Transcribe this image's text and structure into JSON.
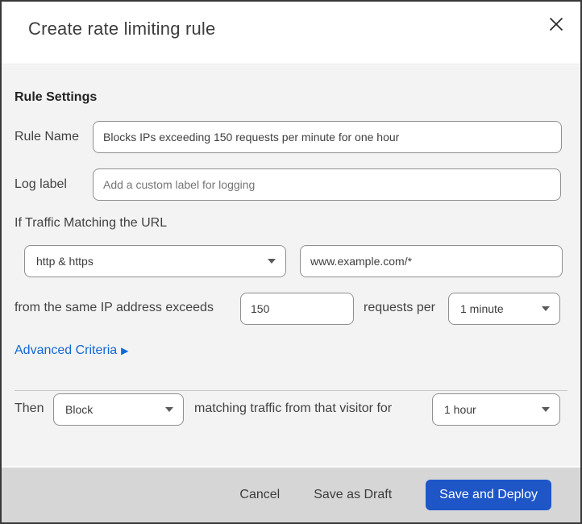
{
  "modal": {
    "title": "Create rate limiting rule",
    "section_heading": "Rule Settings",
    "fields": {
      "rule_name": {
        "label": "Rule Name",
        "value": "Blocks IPs exceeding 150 requests per minute for one hour"
      },
      "log_label": {
        "label": "Log label",
        "placeholder": "Add a custom label for logging"
      },
      "traffic": {
        "label": "If Traffic Matching the URL",
        "scheme_value": "http & https",
        "url_value": "www.example.com/*"
      },
      "threshold": {
        "prefix": "from the same IP address exceeds",
        "requests_value": "150",
        "middle": "requests per",
        "period_value": "1 minute"
      },
      "advanced": {
        "label": "Advanced Criteria",
        "arrow": "▶"
      },
      "action": {
        "prefix": "Then",
        "value": "Block",
        "middle": "matching traffic from that visitor for",
        "duration_value": "1 hour"
      }
    },
    "footer": {
      "cancel_label": "Cancel",
      "save_draft_label": "Save as Draft",
      "save_deploy_label": "Save and Deploy"
    }
  },
  "colors": {
    "primary_button": "#1e56c8",
    "link": "#1268d3",
    "body_bg": "#f3f3f3",
    "footer_bg": "#d6d6d6",
    "input_border": "#8f8f8f",
    "top_strip_navy": "#0e2233",
    "top_strip_red": "#36211f"
  }
}
